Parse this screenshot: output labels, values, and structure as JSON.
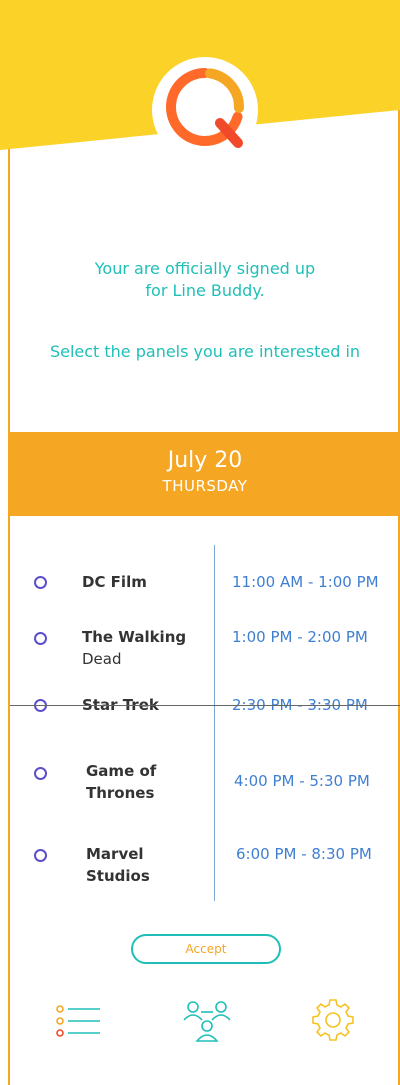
{
  "colors": {
    "accent_orange": "#f5a623",
    "header_yellow": "#fbd227",
    "teal": "#1fbfb8",
    "radio_purple": "#5a4fc9",
    "time_blue": "#3f7fd1"
  },
  "messages": {
    "signup_line1": "Your are officially signed up",
    "signup_line2": "for Line Buddy.",
    "select_prompt": "Select the panels you are interested in"
  },
  "date": {
    "day": "July 20",
    "weekday": "THURSDAY"
  },
  "panels": [
    {
      "name_line1": "DC Film",
      "name_line2": "",
      "time": "11:00 AM - 1:00 PM"
    },
    {
      "name_line1": "The Walking",
      "name_line2": "Dead",
      "time": "1:00 PM - 2:00 PM"
    },
    {
      "name_line1": "Star Trek",
      "name_line2": "",
      "time": "2:30 PM - 3:30 PM"
    },
    {
      "name_line1": "Game of",
      "name_line2": "Thrones",
      "time": "4:00 PM - 5:30 PM"
    },
    {
      "name_line1": "Marvel",
      "name_line2": "Studios",
      "time": "6:00 PM - 8:30 PM"
    }
  ],
  "accept_label": "Accept",
  "nav": {
    "items": [
      {
        "icon": "list-icon"
      },
      {
        "icon": "people-icon"
      },
      {
        "icon": "gear-icon"
      }
    ]
  }
}
